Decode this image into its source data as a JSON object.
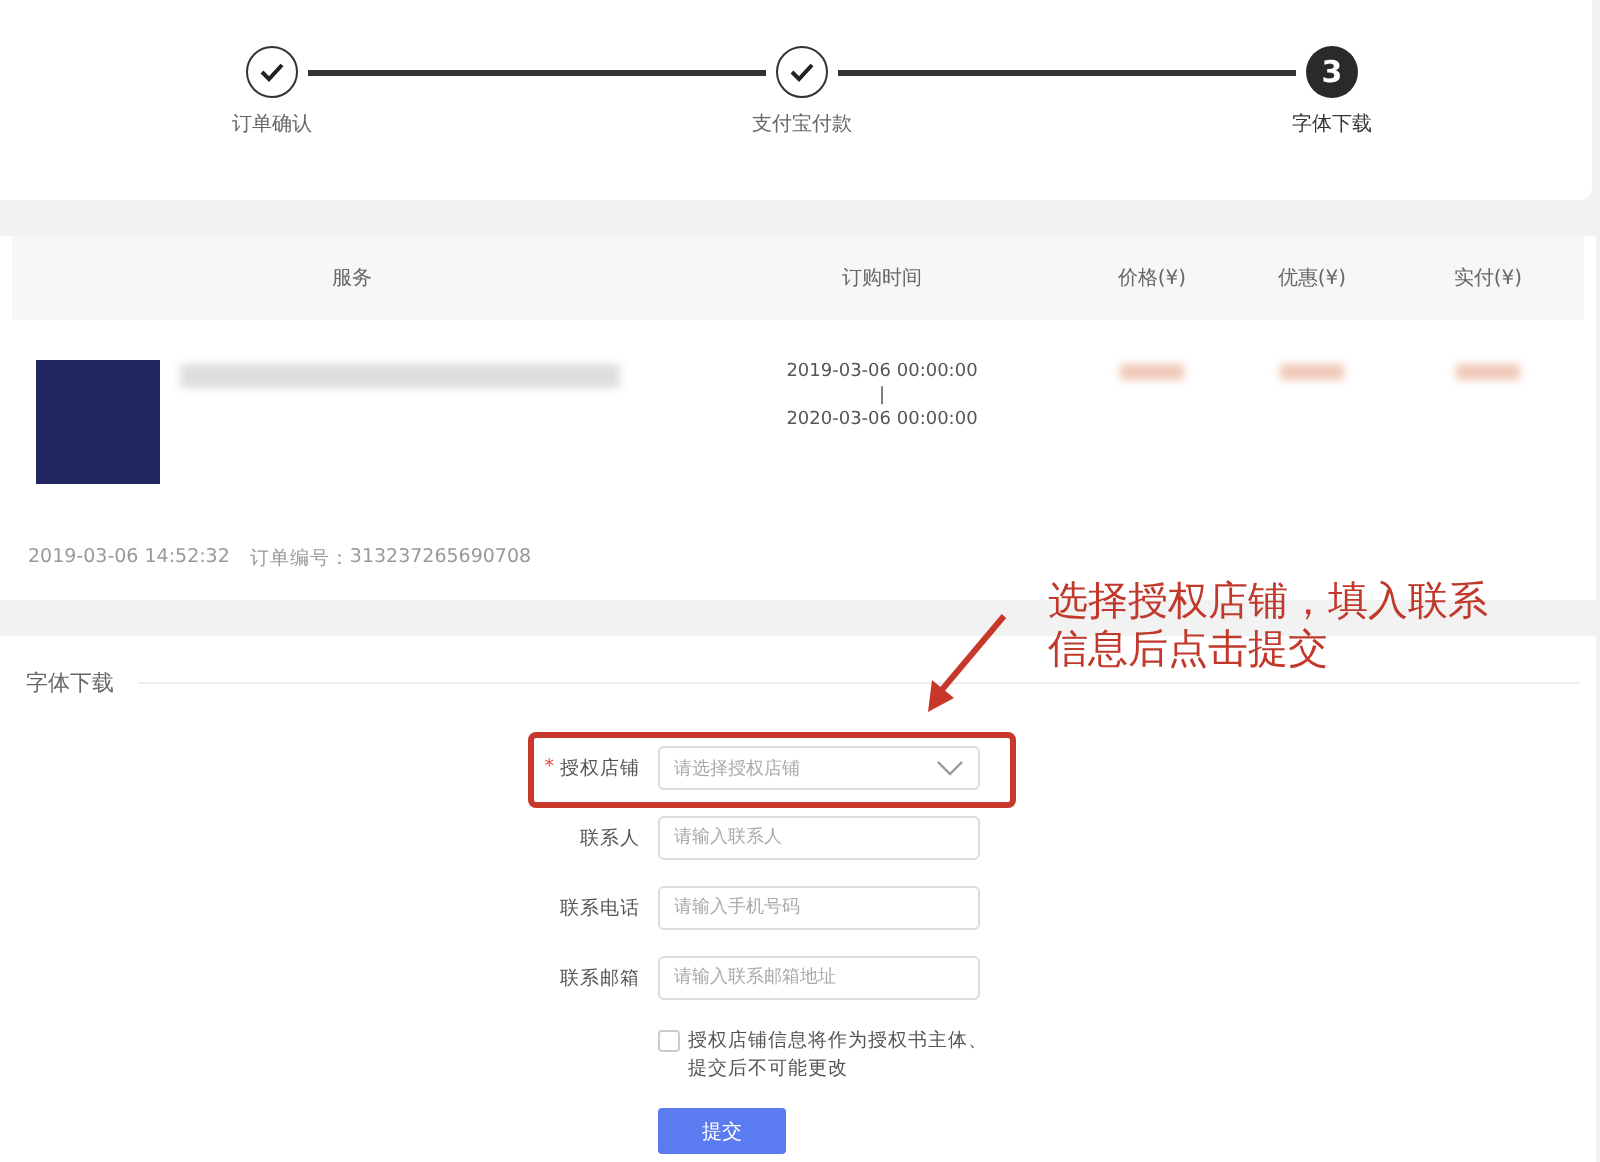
{
  "steps": [
    {
      "label": "订单确认",
      "completed": true
    },
    {
      "label": "支付宝付款",
      "completed": true
    },
    {
      "label": "字体下载",
      "completed": false,
      "number": "3"
    }
  ],
  "order": {
    "columns": [
      "服务",
      "订购时间",
      "价格(¥)",
      "优惠(¥)",
      "实付(¥)"
    ],
    "item": {
      "start": "2019-03-06 00:00:00",
      "separator": "|",
      "end": "2020-03-06 00:00:00"
    },
    "created": "2019-03-06 14:52:32",
    "order_no_label": "订单编号：",
    "order_no": "313237265690708"
  },
  "download": {
    "title": "字体下载",
    "required_mark": "*",
    "fields": [
      {
        "kind": "select",
        "label": "授权店铺",
        "required": true,
        "placeholder": "请选择授权店铺"
      },
      {
        "kind": "input",
        "label": "联系人",
        "required": false,
        "placeholder": "请输入联系人"
      },
      {
        "kind": "input",
        "label": "联系电话",
        "required": false,
        "placeholder": "请输入手机号码"
      },
      {
        "kind": "input",
        "label": "联系邮箱",
        "required": false,
        "placeholder": "请输入联系邮箱地址"
      }
    ],
    "agreement": {
      "checked": false,
      "text": "授权店铺信息将作为授权书主体、提交后不可能更改"
    },
    "submit": "提交"
  },
  "annotation": {
    "text": "选择授权店铺，填入联系信息后点击提交"
  }
}
